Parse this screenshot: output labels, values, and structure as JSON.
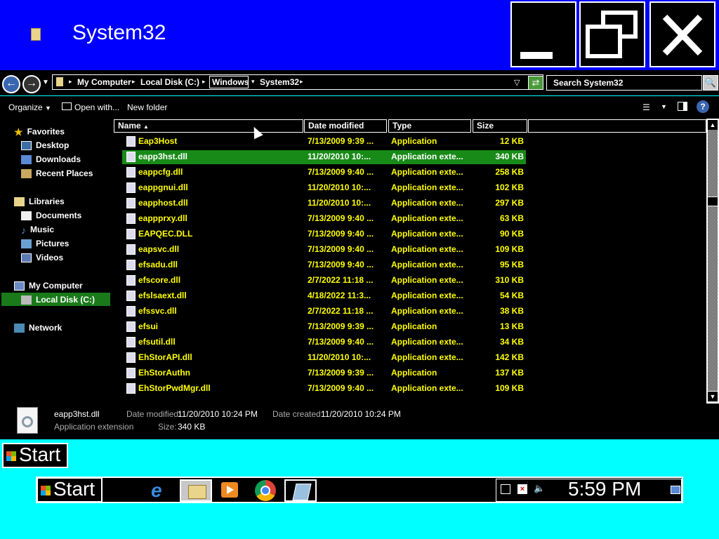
{
  "window": {
    "title": "System32"
  },
  "address": {
    "crumbs": [
      "My Computer",
      "Local Disk (C:)",
      "Windows",
      "System32"
    ],
    "search_placeholder": "Search System32"
  },
  "commands": {
    "organize": "Organize",
    "open_with": "Open with...",
    "new_folder": "New folder"
  },
  "nav": {
    "favorites": "Favorites",
    "desktop": "Desktop",
    "downloads": "Downloads",
    "recent": "Recent Places",
    "libraries": "Libraries",
    "documents": "Documents",
    "music": "Music",
    "pictures": "Pictures",
    "videos": "Videos",
    "computer": "My Computer",
    "local_disk": "Local Disk (C:)",
    "network": "Network"
  },
  "columns": {
    "name": "Name",
    "date": "Date modified",
    "type": "Type",
    "size": "Size"
  },
  "files": [
    {
      "name": "Eap3Host",
      "date": "7/13/2009 9:39 ...",
      "type": "Application",
      "size": "12 KB",
      "icon": "application-icon"
    },
    {
      "name": "eapp3hst.dll",
      "date": "11/20/2010 10:...",
      "type": "Application exte...",
      "size": "340 KB",
      "icon": "dll-icon",
      "selected": true
    },
    {
      "name": "eappcfg.dll",
      "date": "7/13/2009 9:40 ...",
      "type": "Application exte...",
      "size": "258 KB",
      "icon": "dll-icon"
    },
    {
      "name": "eappgnui.dll",
      "date": "11/20/2010 10:...",
      "type": "Application exte...",
      "size": "102 KB",
      "icon": "dll-icon"
    },
    {
      "name": "eapphost.dll",
      "date": "11/20/2010 10:...",
      "type": "Application exte...",
      "size": "297 KB",
      "icon": "dll-icon"
    },
    {
      "name": "eappprxy.dll",
      "date": "7/13/2009 9:40 ...",
      "type": "Application exte...",
      "size": "63 KB",
      "icon": "dll-icon"
    },
    {
      "name": "EAPQEC.DLL",
      "date": "7/13/2009 9:40 ...",
      "type": "Application exte...",
      "size": "90 KB",
      "icon": "dll-icon"
    },
    {
      "name": "eapsvc.dll",
      "date": "7/13/2009 9:40 ...",
      "type": "Application exte...",
      "size": "109 KB",
      "icon": "dll-icon"
    },
    {
      "name": "efsadu.dll",
      "date": "7/13/2009 9:40 ...",
      "type": "Application exte...",
      "size": "95 KB",
      "icon": "dll-icon"
    },
    {
      "name": "efscore.dll",
      "date": "2/7/2022 11:18 ...",
      "type": "Application exte...",
      "size": "310 KB",
      "icon": "dll-icon"
    },
    {
      "name": "efslsaext.dll",
      "date": "4/18/2022 11:3...",
      "type": "Application exte...",
      "size": "54 KB",
      "icon": "dll-icon"
    },
    {
      "name": "efssvc.dll",
      "date": "2/7/2022 11:18 ...",
      "type": "Application exte...",
      "size": "38 KB",
      "icon": "dll-icon"
    },
    {
      "name": "efsui",
      "date": "7/13/2009 9:39 ...",
      "type": "Application",
      "size": "13 KB",
      "icon": "application-icon"
    },
    {
      "name": "efsutil.dll",
      "date": "7/13/2009 9:40 ...",
      "type": "Application exte...",
      "size": "34 KB",
      "icon": "dll-icon"
    },
    {
      "name": "EhStorAPI.dll",
      "date": "11/20/2010 10:...",
      "type": "Application exte...",
      "size": "142 KB",
      "icon": "dll-icon"
    },
    {
      "name": "EhStorAuthn",
      "date": "7/13/2009 9:39 ...",
      "type": "Application",
      "size": "137 KB",
      "icon": "users-icon"
    },
    {
      "name": "EhStorPwdMgr.dll",
      "date": "7/13/2009 9:40 ...",
      "type": "Application exte...",
      "size": "109 KB",
      "icon": "dll-icon"
    }
  ],
  "details": {
    "name": "eapp3hst.dll",
    "type": "Application extension",
    "modified_label": "Date modified:",
    "modified": "11/20/2010 10:24 PM",
    "size_label": "Size:",
    "size": "340 KB",
    "created_label": "Date created:",
    "created": "11/20/2010 10:24 PM"
  },
  "start": {
    "label": "Start"
  },
  "taskbar": {
    "start": "Start",
    "clock": "5:59 PM"
  }
}
